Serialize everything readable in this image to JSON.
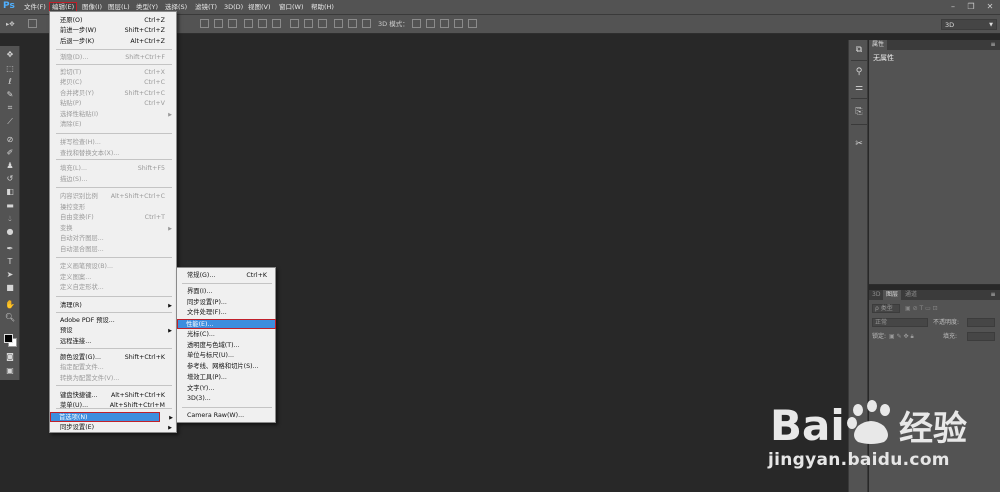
{
  "app": {
    "logo": "Ps"
  },
  "menubar": {
    "items": [
      "文件(F)",
      "编辑(E)",
      "图像(I)",
      "图层(L)",
      "类型(Y)",
      "选择(S)",
      "滤镜(T)",
      "3D(D)",
      "视图(V)",
      "窗口(W)",
      "帮助(H)"
    ],
    "active_index": 1,
    "window_controls": [
      "minimize-icon",
      "restore-icon",
      "close-icon"
    ]
  },
  "options_bar": {
    "mode_3d_label": "3D 模式：",
    "workspace_select": "3D"
  },
  "edit_menu": {
    "items": [
      {
        "label": "还原(O)",
        "shortcut": "Ctrl+Z",
        "enabled": true
      },
      {
        "label": "前进一步(W)",
        "shortcut": "Shift+Ctrl+Z",
        "enabled": true
      },
      {
        "label": "后退一步(K)",
        "shortcut": "Alt+Ctrl+Z",
        "enabled": true
      },
      {
        "label": "渐隐(D)...",
        "shortcut": "Shift+Ctrl+F",
        "enabled": false
      },
      {
        "label": "剪切(T)",
        "shortcut": "Ctrl+X",
        "enabled": false
      },
      {
        "label": "拷贝(C)",
        "shortcut": "Ctrl+C",
        "enabled": false
      },
      {
        "label": "合并拷贝(Y)",
        "shortcut": "Shift+Ctrl+C",
        "enabled": false
      },
      {
        "label": "粘贴(P)",
        "shortcut": "Ctrl+V",
        "enabled": false
      },
      {
        "label": "选择性粘贴(I)",
        "shortcut": "",
        "enabled": false,
        "submenu": true
      },
      {
        "label": "清除(E)",
        "shortcut": "",
        "enabled": false
      },
      {
        "label": "拼写检查(H)...",
        "shortcut": "",
        "enabled": false
      },
      {
        "label": "查找和替换文本(X)...",
        "shortcut": "",
        "enabled": false
      },
      {
        "label": "填充(L)...",
        "shortcut": "Shift+F5",
        "enabled": false
      },
      {
        "label": "描边(S)...",
        "shortcut": "",
        "enabled": false
      },
      {
        "label": "内容识别比例",
        "shortcut": "Alt+Shift+Ctrl+C",
        "enabled": false
      },
      {
        "label": "操控变形",
        "shortcut": "",
        "enabled": false
      },
      {
        "label": "自由变换(F)",
        "shortcut": "Ctrl+T",
        "enabled": false
      },
      {
        "label": "变换",
        "shortcut": "",
        "enabled": false,
        "submenu": true
      },
      {
        "label": "自动对齐图层...",
        "shortcut": "",
        "enabled": false
      },
      {
        "label": "自动混合图层...",
        "shortcut": "",
        "enabled": false
      },
      {
        "label": "定义画笔预设(B)...",
        "shortcut": "",
        "enabled": false
      },
      {
        "label": "定义图案...",
        "shortcut": "",
        "enabled": false
      },
      {
        "label": "定义自定形状...",
        "shortcut": "",
        "enabled": false
      },
      {
        "label": "清理(R)",
        "shortcut": "",
        "enabled": true,
        "submenu": true
      },
      {
        "label": "Adobe PDF 预设...",
        "shortcut": "",
        "enabled": true
      },
      {
        "label": "预设",
        "shortcut": "",
        "enabled": true,
        "submenu": true
      },
      {
        "label": "远程连接...",
        "shortcut": "",
        "enabled": true
      },
      {
        "label": "颜色设置(G)...",
        "shortcut": "Shift+Ctrl+K",
        "enabled": true
      },
      {
        "label": "指定配置文件...",
        "shortcut": "",
        "enabled": false
      },
      {
        "label": "转换为配置文件(V)...",
        "shortcut": "",
        "enabled": false
      },
      {
        "label": "键盘快捷键...",
        "shortcut": "Alt+Shift+Ctrl+K",
        "enabled": true
      },
      {
        "label": "菜单(U)...",
        "shortcut": "Alt+Shift+Ctrl+M",
        "enabled": true
      },
      {
        "label": "首选项(N)",
        "shortcut": "",
        "enabled": true,
        "submenu": true,
        "highlighted": true
      },
      {
        "label": "同步设置(E)",
        "shortcut": "",
        "enabled": true,
        "submenu": true
      }
    ]
  },
  "pref_menu": {
    "items": [
      {
        "label": "常规(G)...",
        "shortcut": "Ctrl+K"
      },
      {
        "label": "界面(I)...",
        "shortcut": ""
      },
      {
        "label": "同步设置(P)...",
        "shortcut": ""
      },
      {
        "label": "文件处理(F)...",
        "shortcut": ""
      },
      {
        "label": "性能(E)...",
        "shortcut": "",
        "highlighted": true
      },
      {
        "label": "光标(C)...",
        "shortcut": ""
      },
      {
        "label": "透明度与色域(T)...",
        "shortcut": ""
      },
      {
        "label": "单位与标尺(U)...",
        "shortcut": ""
      },
      {
        "label": "参考线、网格和切片(S)...",
        "shortcut": ""
      },
      {
        "label": "增效工具(P)...",
        "shortcut": ""
      },
      {
        "label": "文字(Y)...",
        "shortcut": ""
      },
      {
        "label": "3D(3)...",
        "shortcut": ""
      },
      {
        "label": "Camera Raw(W)...",
        "shortcut": ""
      }
    ]
  },
  "properties_panel": {
    "tab": "属性",
    "content": "无属性"
  },
  "layers_panel": {
    "tabs": [
      "3D",
      "图层",
      "通道"
    ],
    "active_tab": 1,
    "filter_label": "ρ 类型",
    "blend_mode": "正常",
    "opacity_label": "不透明度:",
    "lock_label": "锁定:",
    "fill_label": "填充:"
  },
  "watermark": {
    "logo_text": "Bai 经验",
    "url": "jingyan.baidu.com"
  }
}
